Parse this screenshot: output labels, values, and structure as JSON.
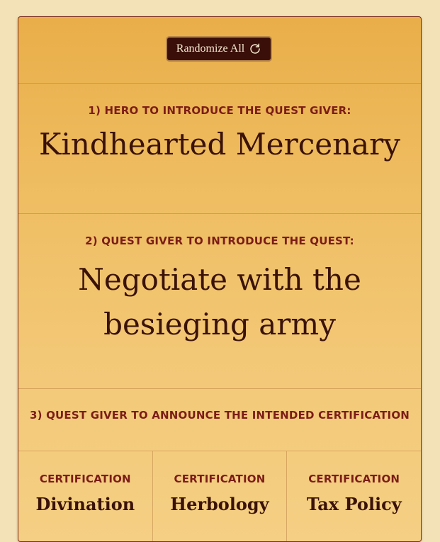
{
  "toolbar": {
    "randomize_label": "Randomize All",
    "icon": "refresh-icon"
  },
  "sections": [
    {
      "heading": "1) Hero to introduce the quest giver:",
      "value": "Kindhearted Mercenary"
    },
    {
      "heading": "2) Quest giver to introduce the quest:",
      "value": "Negotiate with the besieging army"
    },
    {
      "heading": "3) Quest giver to announce the intended certification",
      "value": ""
    }
  ],
  "certifications": [
    {
      "heading": "Certification",
      "value": "Divination"
    },
    {
      "heading": "Certification",
      "value": "Herbology"
    },
    {
      "heading": "Certification",
      "value": "Tax Policy"
    }
  ],
  "colors": {
    "accent": "#7c1d17",
    "button_bg": "#3a0f09",
    "card_top": "#e9ae49",
    "card_bottom": "#f5cf84",
    "page_bg": "#f3e2b8"
  }
}
